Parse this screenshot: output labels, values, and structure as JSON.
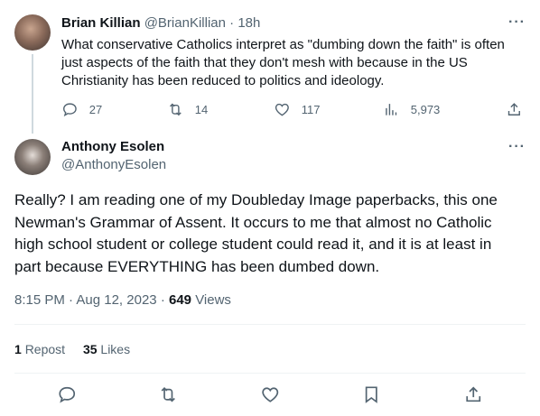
{
  "reply_tweet": {
    "author_name": "Brian Killian",
    "author_handle": "@BrianKillian",
    "separator": "·",
    "time": "18h",
    "text": "What conservative Catholics interpret as \"dumbing down the faith\" is often just aspects of the faith that they don't mesh with because in the US Christianity has been reduced to politics and ideology.",
    "stats": {
      "replies": "27",
      "retweets": "14",
      "likes": "117",
      "views": "5,973"
    }
  },
  "main_tweet": {
    "author_name": "Anthony Esolen",
    "author_handle": "@AnthonyEsolen",
    "text": "Really? I am reading one of my Doubleday Image paperbacks, this one Newman's Grammar of Assent. It occurs to me that almost no Catholic high school student or college student could read it, and it is at least in part because EVERYTHING has been dumbed down.",
    "time": "8:15 PM",
    "date": "Aug 12, 2023",
    "separator": "·",
    "views_count": "649",
    "views_label": "Views",
    "reposts_count": "1",
    "reposts_label": "Repost",
    "likes_count": "35",
    "likes_label": "Likes"
  },
  "more_glyph": "···"
}
